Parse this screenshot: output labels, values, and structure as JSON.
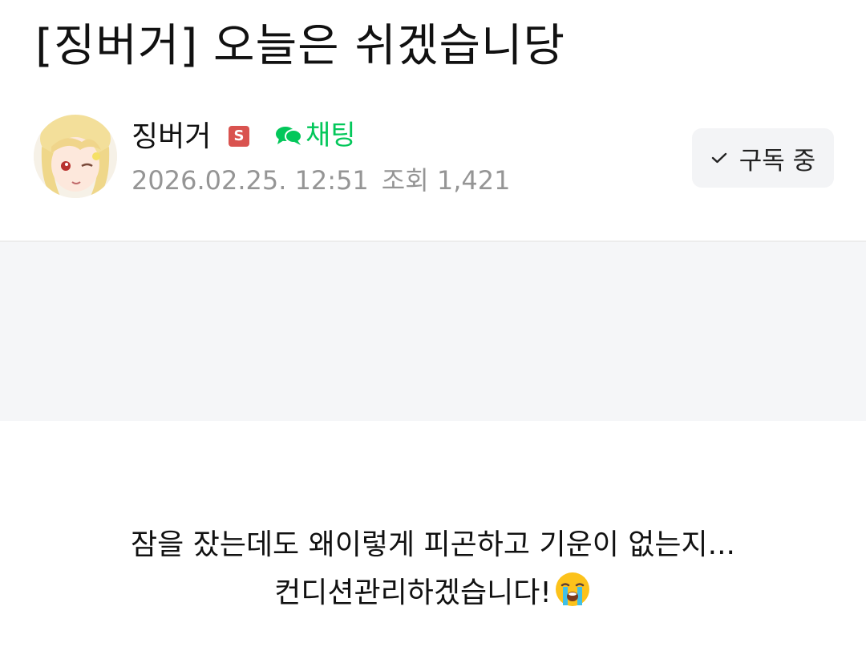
{
  "post": {
    "title": "[징버거] 오늘은 쉬겠습니당",
    "body_lines": [
      "잠을 잤는데도 왜이렇게 피곤하고 기운이 없는지...",
      "컨디션관리하겠습니다!"
    ],
    "body_trailing_icon": "loudly-crying-face-icon"
  },
  "author": {
    "name": "징버거",
    "badge_label": "S",
    "chat_label": "채팅",
    "date": "2026.02.25. 12:51",
    "views_label": "조회 1,421"
  },
  "subscribe": {
    "label": "구독 중"
  },
  "colors": {
    "chat_green": "#03c75a",
    "badge_red": "#d9534f",
    "meta_gray": "#959595",
    "placeholder_bg": "#f5f6f8"
  }
}
